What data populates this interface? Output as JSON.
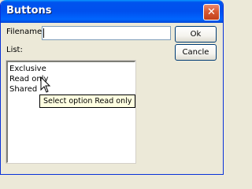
{
  "window": {
    "title": "Buttons",
    "close_glyph": "✕"
  },
  "form": {
    "filename_label": "Filename:",
    "filename_value": "",
    "list_label": "List:"
  },
  "buttons": {
    "ok_label": "Ok",
    "cancel_label": "Cancle"
  },
  "list": {
    "items": [
      "Exclusive",
      "Read only",
      "Shared"
    ]
  },
  "tooltip": {
    "text": "Select option Read only"
  },
  "colors": {
    "titlebar": "#0053ee",
    "window_bg": "#ece9d8",
    "close_button": "#d85a34",
    "tooltip_bg": "#ffffe1"
  },
  "icons": {
    "close": "close-icon",
    "cursor": "arrow-cursor-icon"
  }
}
